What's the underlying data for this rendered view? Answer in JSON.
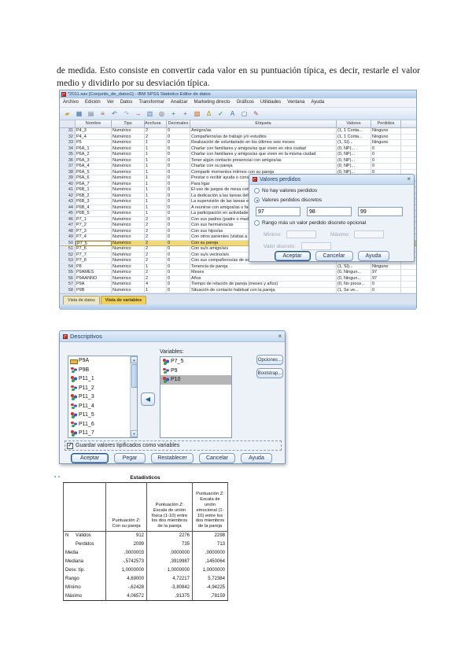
{
  "doc": {
    "paragraph": "de medida. Esto consiste en convertir cada valor en su puntuación típica, es decir, restarle el valor medio y dividirlo por su desviación típica."
  },
  "spss": {
    "title": "*2011.sav [Conjunto_de_datos1] - IBM SPSS Statistics Editor de datos",
    "menus": [
      "Archivo",
      "Edición",
      "Ver",
      "Datos",
      "Transformar",
      "Analizar",
      "Marketing directo",
      "Gráficos",
      "Utilidades",
      "Ventana",
      "Ayuda"
    ],
    "toolbar_icons": [
      {
        "name": "open-data-icon",
        "ch": "▰",
        "c": "#d8a33a"
      },
      {
        "name": "save-icon",
        "ch": "▦",
        "c": "#3a6ea5"
      },
      {
        "name": "print-icon",
        "ch": "▤",
        "c": "#6b7d94"
      },
      {
        "name": "recall-dialogs-icon",
        "ch": "≡",
        "c": "#b04a3a"
      },
      {
        "name": "undo-icon",
        "ch": "↶",
        "c": "#2e75b6"
      },
      {
        "name": "redo-icon",
        "ch": "↷",
        "c": "#9ab0c8"
      },
      {
        "name": "goto-case-icon",
        "ch": "→",
        "c": "#c03030"
      },
      {
        "name": "variables-icon",
        "ch": "▥",
        "c": "#4a7ab5"
      },
      {
        "name": "find-icon",
        "ch": "◎",
        "c": "#555555"
      },
      {
        "name": "insert-case-icon",
        "ch": "+",
        "c": "#2e8b57"
      },
      {
        "name": "insert-variable-icon",
        "ch": "+",
        "c": "#7a5fc0"
      },
      {
        "name": "split-file-icon",
        "ch": "▧",
        "c": "#c55a11"
      },
      {
        "name": "weight-cases-icon",
        "ch": "Δ",
        "c": "#b58b00"
      },
      {
        "name": "select-cases-icon",
        "ch": "✓",
        "c": "#2a7a2a"
      },
      {
        "name": "value-labels-icon",
        "ch": "A",
        "c": "#3a6ea5"
      },
      {
        "name": "use-sets-icon",
        "ch": "▢",
        "c": "#666666"
      },
      {
        "name": "spelling-icon",
        "ch": "✎",
        "c": "#a05050"
      }
    ],
    "columns": [
      "Nombre",
      "Tipo",
      "Anchura",
      "Decimales",
      "Etiqueta",
      "Valores",
      "Perdidos"
    ],
    "rows": [
      {
        "n": "31",
        "name": "P4_3",
        "type": "Numérico",
        "w": "2",
        "d": "0",
        "label": "Amigos/as",
        "val": "(1, 1 Conta...",
        "miss": "Ninguno"
      },
      {
        "n": "32",
        "name": "P4_4",
        "type": "Numérico",
        "w": "2",
        "d": "0",
        "label": "Compañeros/as de trabajo y/o estudios",
        "val": "(1, 1 Conta...",
        "miss": "Ninguno"
      },
      {
        "n": "33",
        "name": "P5",
        "type": "Numérico",
        "w": "1",
        "d": "0",
        "label": "Realización de voluntariado en los últimos seis meses",
        "val": "(1, Sí)...",
        "miss": "Ninguno"
      },
      {
        "n": "34",
        "name": "P6A_1",
        "type": "Numérico",
        "w": "1",
        "d": "0",
        "label": "Charlar con familiares y amigos/as que viven en otra ciudad",
        "val": "(0, NP)...",
        "miss": "0"
      },
      {
        "n": "35",
        "name": "P6A_2",
        "type": "Numérico",
        "w": "1",
        "d": "0",
        "label": "Charlar con familiares y amigos/as que viven en la misma ciudad",
        "val": "(0, NP)...",
        "miss": "0"
      },
      {
        "n": "36",
        "name": "P6A_3",
        "type": "Numérico",
        "w": "1",
        "d": "0",
        "label": "Tener algún contacto presencial con amigos/as",
        "val": "(0, NP)...",
        "miss": "0"
      },
      {
        "n": "37",
        "name": "P6A_4",
        "type": "Numérico",
        "w": "1",
        "d": "0",
        "label": "Charlar con su pareja",
        "val": "(0, NP)...",
        "miss": "0"
      },
      {
        "n": "38",
        "name": "P6A_5",
        "type": "Numérico",
        "w": "1",
        "d": "0",
        "label": "Compartir momentos íntimos con su pareja",
        "val": "(0, NP)...",
        "miss": "0"
      },
      {
        "n": "39",
        "name": "P6A_6",
        "type": "Numérico",
        "w": "1",
        "d": "0",
        "label": "Prestar o recibir ayuda o consejos de alguna f...",
        "val": "",
        "miss": ""
      },
      {
        "n": "40",
        "name": "P6A_7",
        "type": "Numérico",
        "w": "1",
        "d": "0",
        "label": "Para ligar",
        "val": "",
        "miss": ""
      },
      {
        "n": "41",
        "name": "P6B_1",
        "type": "Numérico",
        "w": "1",
        "d": "0",
        "label": "El uso de juegos de mesa con su familia (aje...",
        "val": "",
        "miss": ""
      },
      {
        "n": "42",
        "name": "P6B_2",
        "type": "Numérico",
        "w": "1",
        "d": "0",
        "label": "La dedicación a las tareas del hogar: cocinar...",
        "val": "",
        "miss": ""
      },
      {
        "n": "43",
        "name": "P6B_3",
        "type": "Numérico",
        "w": "1",
        "d": "0",
        "label": "La supervisión de las tareas escolares de sus...",
        "val": "",
        "miss": ""
      },
      {
        "n": "44",
        "name": "P6B_4",
        "type": "Numérico",
        "w": "1",
        "d": "0",
        "label": "A reunirse con amigos/as o familiares para c...",
        "val": "",
        "miss": ""
      },
      {
        "n": "45",
        "name": "P6B_5",
        "type": "Numérico",
        "w": "1",
        "d": "0",
        "label": "La participación en actividades vecinales y/o d...",
        "val": "",
        "miss": ""
      },
      {
        "n": "46",
        "name": "P7_1",
        "type": "Numérico",
        "w": "2",
        "d": "0",
        "label": "Con sus padres (padre o madre)",
        "val": "",
        "miss": ""
      },
      {
        "n": "47",
        "name": "P7_2",
        "type": "Numérico",
        "w": "2",
        "d": "0",
        "label": "Con sus hermanos/as",
        "val": "",
        "miss": ""
      },
      {
        "n": "48",
        "name": "P7_3",
        "type": "Numérico",
        "w": "2",
        "d": "0",
        "label": "Con sus hijos/as",
        "val": "",
        "miss": ""
      },
      {
        "n": "49",
        "name": "P7_4",
        "type": "Numérico",
        "w": "2",
        "d": "0",
        "label": "Con otros parientes (visitas a padres, herma...",
        "val": "",
        "miss": ""
      },
      {
        "n": "50",
        "name": "P7_5",
        "type": "Numérico",
        "w": "2",
        "d": "0",
        "label": "Con su pareja",
        "val": "",
        "miss": "",
        "cls": "sel"
      },
      {
        "n": "51",
        "name": "P7_6",
        "type": "Numérico",
        "w": "2",
        "d": "0",
        "label": "Con su/s amigo/a/s",
        "val": "",
        "miss": ""
      },
      {
        "n": "52",
        "name": "P7_7",
        "type": "Numérico",
        "w": "2",
        "d": "0",
        "label": "Con su/s vecino/a/s",
        "val": "",
        "miss": ""
      },
      {
        "n": "53",
        "name": "P7_8",
        "type": "Numérico",
        "w": "2",
        "d": "0",
        "label": "Con sus compañeros/as de estudios o trabajo",
        "val": "",
        "miss": ""
      },
      {
        "n": "54",
        "name": "P8",
        "type": "Numérico",
        "w": "1",
        "d": "0",
        "label": "Tenencia de pareja",
        "val": "(1, Sí)...",
        "miss": "Ninguno"
      },
      {
        "n": "55",
        "name": "P9AMES",
        "type": "Numérico",
        "w": "2",
        "d": "0",
        "label": "Meses",
        "val": "(0, Ningun...",
        "miss": "97"
      },
      {
        "n": "56",
        "name": "P9AANNO",
        "type": "Numérico",
        "w": "2",
        "d": "0",
        "label": "Años",
        "val": "(0, Ningun...",
        "miss": "97"
      },
      {
        "n": "57",
        "name": "P9A",
        "type": "Numérico",
        "w": "4",
        "d": "0",
        "label": "Tiempo de relación de pareja (meses y años)",
        "val": "(0, No proce...",
        "miss": "0"
      },
      {
        "n": "58",
        "name": "P9B",
        "type": "Numérico",
        "w": "1",
        "d": "0",
        "label": "Situación de contacto habitual con la pareja",
        "val": "(1, Se ve...",
        "miss": "0"
      }
    ],
    "tabs": [
      {
        "label": "Vista de datos"
      },
      {
        "label": "Vista de variables",
        "cls": "active"
      }
    ]
  },
  "missing_dialog": {
    "title": "Valores perdidos",
    "opt_none": "No hay valores perdidos",
    "opt_discrete": "Valores perdidos discretos",
    "values": [
      "97",
      "98",
      "99"
    ],
    "opt_range": "Rango más un valor perdido discreto opcional",
    "min_label": "Mínimo:",
    "max_label": "Máximo:",
    "discrete_label": "Valor discreto:",
    "ok": "Aceptar",
    "cancel": "Cancelar",
    "help": "Ayuda"
  },
  "descriptives_dialog": {
    "title": "Descriptivos",
    "source_items": [
      {
        "label": "P9A",
        "ic": "scale"
      },
      {
        "label": "P9B",
        "ic": "nom"
      },
      {
        "label": "P11_1",
        "ic": "nom"
      },
      {
        "label": "P11_2",
        "ic": "nom"
      },
      {
        "label": "P11_3",
        "ic": "nom"
      },
      {
        "label": "P11_4",
        "ic": "nom"
      },
      {
        "label": "P11_5",
        "ic": "nom"
      },
      {
        "label": "P11_6",
        "ic": "nom"
      },
      {
        "label": "P11_7",
        "ic": "nom"
      }
    ],
    "variables_label": "Variables:",
    "selected_items": [
      {
        "label": "P7_5",
        "ic": "nom"
      },
      {
        "label": "P9",
        "ic": "nom"
      },
      {
        "label": "P10",
        "ic": "nom",
        "cls": "sel"
      }
    ],
    "options_button": "Opciones...",
    "bootstrap_button": "Bootstrap...",
    "save_standardized": "Guardar valores tipificados como variables",
    "ok": "Aceptar",
    "paste": "Pegar",
    "reset": "Restablecer",
    "cancel": "Cancelar",
    "help": "Ayuda"
  },
  "stats": {
    "title": "Estadísticos",
    "col_headers": [
      "Puntuación Z:  Con su pareja",
      "Puntuación Z:  Escala de unión física (1-10) entre los dos miembros de la pareja",
      "Puntuación Z:  Escala de unión emocional (1-10) entre los dos miembros de la pareja"
    ],
    "rows": [
      {
        "a": "N",
        "b": "Válidos",
        "v": [
          "912",
          "2276",
          "2298"
        ]
      },
      {
        "a": "",
        "b": "Perdidos",
        "v": [
          "2099",
          "735",
          "713"
        ]
      },
      {
        "a": "Media",
        "b": "",
        "v": [
          ",0000003",
          ",0000000",
          ",0000000"
        ]
      },
      {
        "a": "Mediana",
        "b": "",
        "v": [
          "-,5742573",
          ",3919987",
          ",1450064"
        ]
      },
      {
        "a": "Desv. típ.",
        "b": "",
        "v": [
          "1,0000000",
          "1,0000000",
          "1,0000000"
        ]
      },
      {
        "a": "Rango",
        "b": "",
        "v": [
          "4,69000",
          "4,72217",
          "5,72384"
        ]
      },
      {
        "a": "Mínimo",
        "b": "",
        "v": [
          "-,62428",
          "-3,80842",
          "-4,94225"
        ]
      },
      {
        "a": "Máximo",
        "b": "",
        "v": [
          "4,06572",
          ",91375",
          ",78159"
        ]
      }
    ]
  }
}
